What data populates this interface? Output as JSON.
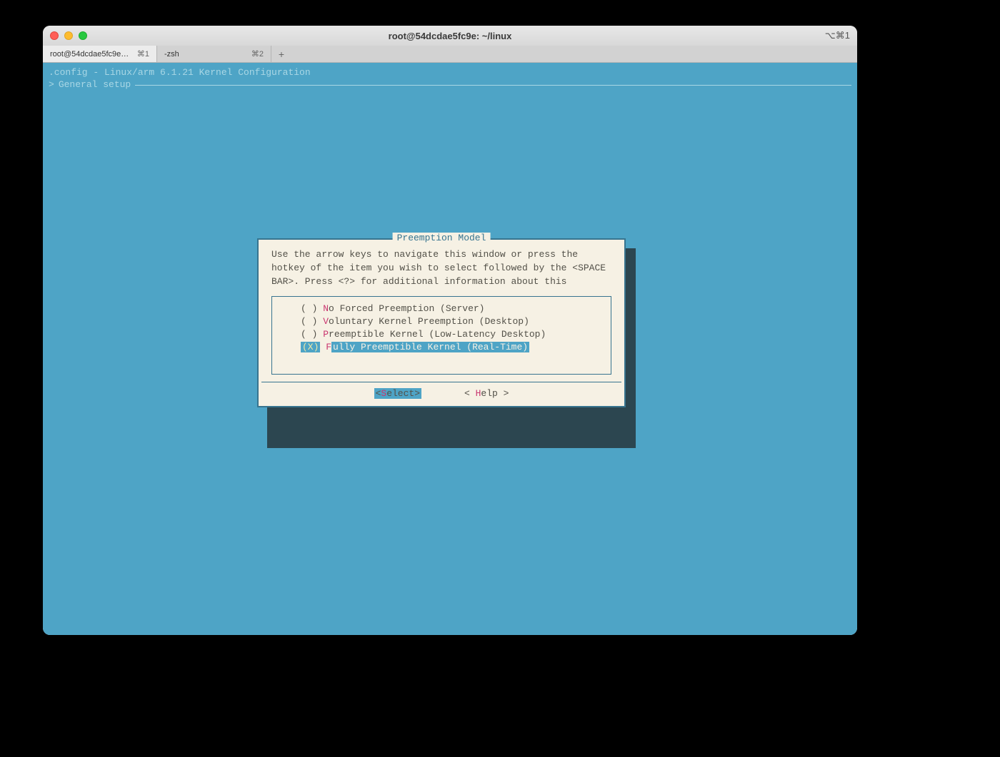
{
  "window": {
    "title": "root@54dcdae5fc9e: ~/linux",
    "right_indicator": "⌥⌘1"
  },
  "tabs": [
    {
      "label": "root@54dcdae5fc9e…",
      "kb": "⌘1",
      "active": true
    },
    {
      "label": "-zsh",
      "kb": "⌘2",
      "active": false
    }
  ],
  "tui": {
    "header": ".config - Linux/arm 6.1.21 Kernel Configuration",
    "breadcrumb_prefix": ">",
    "breadcrumb": "General setup"
  },
  "dialog": {
    "title": "Preemption Model",
    "instructions": "Use the arrow keys to navigate this window or press the hotkey of the item you wish to select followed by the <SPACE BAR>. Press <?> for additional information about this",
    "options": [
      {
        "radio": "( )",
        "hotkey": "N",
        "rest": "o Forced Preemption (Server)",
        "selected": false
      },
      {
        "radio": "( )",
        "hotkey": "V",
        "rest": "oluntary Kernel Preemption (Desktop)",
        "selected": false
      },
      {
        "radio": "( )",
        "hotkey": "P",
        "rest": "reemptible Kernel (Low-Latency Desktop)",
        "selected": false
      },
      {
        "radio": "(X)",
        "hotkey": "F",
        "rest": "ully Preemptible Kernel (Real-Time)",
        "selected": true
      }
    ],
    "buttons": {
      "select": {
        "open": "<",
        "hotkey": "S",
        "rest": "elect>",
        "highlighted": true
      },
      "help": {
        "open": "< ",
        "hotkey": "H",
        "rest": "elp >",
        "highlighted": false
      }
    }
  }
}
